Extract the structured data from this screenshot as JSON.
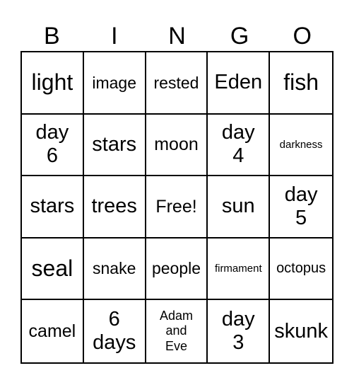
{
  "header": [
    "B",
    "I",
    "N",
    "G",
    "O"
  ],
  "rows": [
    [
      {
        "text": "light",
        "size": "s34"
      },
      {
        "text": "image",
        "size": "s24"
      },
      {
        "text": "rested",
        "size": "s24"
      },
      {
        "text": "Eden",
        "size": "s30"
      },
      {
        "text": "fish",
        "size": "s34"
      }
    ],
    [
      {
        "text": "day\n6",
        "size": "s30"
      },
      {
        "text": "stars",
        "size": "s30"
      },
      {
        "text": "moon",
        "size": "s26"
      },
      {
        "text": "day\n4",
        "size": "s30"
      },
      {
        "text": "darkness",
        "size": "s15"
      }
    ],
    [
      {
        "text": "stars",
        "size": "s30"
      },
      {
        "text": "trees",
        "size": "s30"
      },
      {
        "text": "Free!",
        "size": "s26"
      },
      {
        "text": "sun",
        "size": "s30"
      },
      {
        "text": "day\n5",
        "size": "s30"
      }
    ],
    [
      {
        "text": "seal",
        "size": "s34"
      },
      {
        "text": "snake",
        "size": "s24"
      },
      {
        "text": "people",
        "size": "s24"
      },
      {
        "text": "firmament",
        "size": "s15"
      },
      {
        "text": "octopus",
        "size": "s21"
      }
    ],
    [
      {
        "text": "camel",
        "size": "s26"
      },
      {
        "text": "6\ndays",
        "size": "s30"
      },
      {
        "text": "Adam\nand\nEve",
        "size": "s18"
      },
      {
        "text": "day\n3",
        "size": "s30"
      },
      {
        "text": "skunk",
        "size": "s30"
      }
    ]
  ]
}
